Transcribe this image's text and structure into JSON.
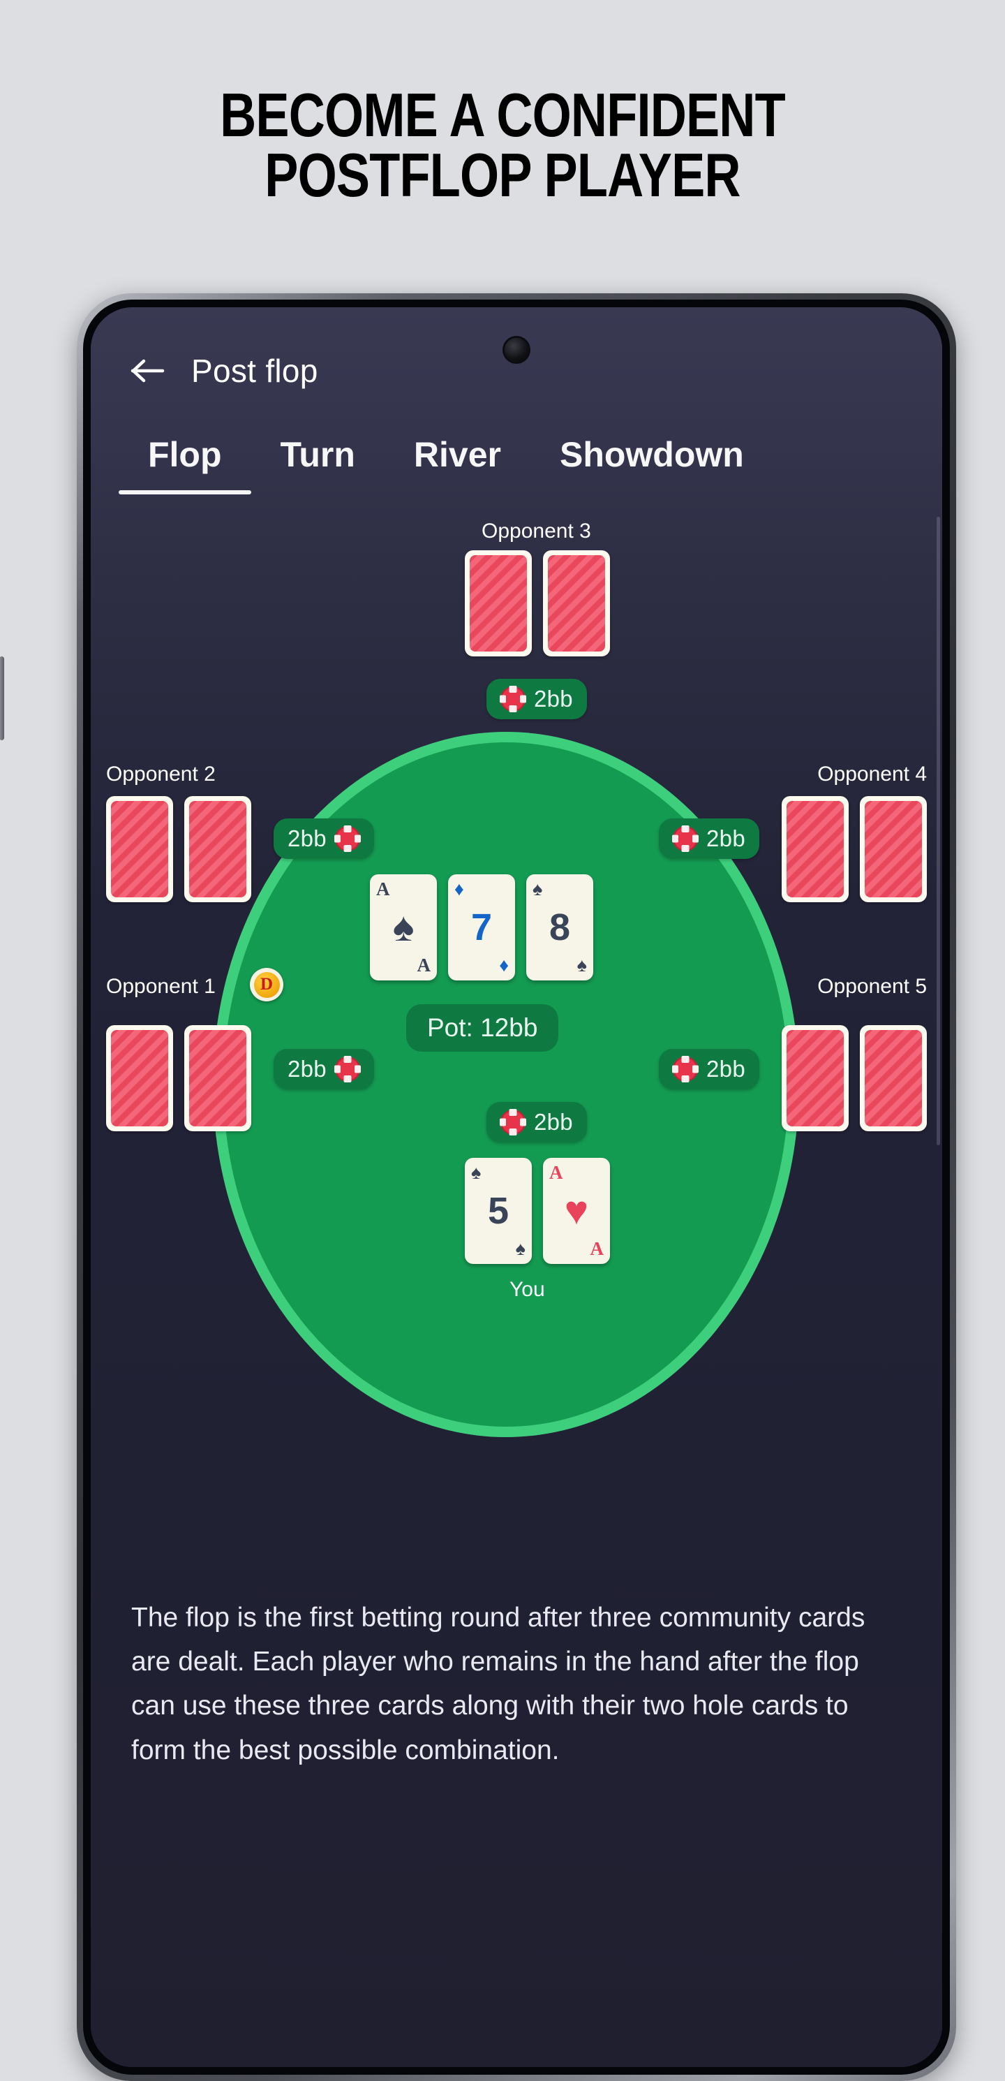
{
  "headline": {
    "line1": "BECOME A CONFIDENT",
    "line2": "POSTFLOP PLAYER"
  },
  "app": {
    "back_icon": "arrow-left-icon",
    "title": "Post flop",
    "tabs": [
      {
        "label": "Flop",
        "active": true
      },
      {
        "label": "Turn",
        "active": false
      },
      {
        "label": "River",
        "active": false
      },
      {
        "label": "Showdown",
        "active": false
      }
    ]
  },
  "table": {
    "pot_label": "Pot: 12bb",
    "dealer_badge": "D",
    "felt_color": "#149b52",
    "felt_rim_color": "#3ecf7d",
    "bet_badge_color": "#0e7a42",
    "chip_color": "#e8344a",
    "seats": [
      {
        "id": "opponent-3",
        "name": "Opponent 3",
        "bet": "2bb",
        "cards": "hidden"
      },
      {
        "id": "opponent-2",
        "name": "Opponent 2",
        "bet": "2bb",
        "cards": "hidden"
      },
      {
        "id": "opponent-4",
        "name": "Opponent 4",
        "bet": "2bb",
        "cards": "hidden"
      },
      {
        "id": "opponent-1",
        "name": "Opponent 1",
        "bet": "2bb",
        "cards": "hidden",
        "dealer": true
      },
      {
        "id": "opponent-5",
        "name": "Opponent 5",
        "bet": "2bb",
        "cards": "hidden"
      },
      {
        "id": "you",
        "name": "You",
        "bet": "2bb",
        "cards": "shown"
      }
    ],
    "community_cards": [
      {
        "rank": "A",
        "suit": "♠",
        "suit_name": "spade",
        "color": "#3a4458"
      },
      {
        "rank": "7",
        "suit": "♦",
        "suit_name": "diamond",
        "color": "#1565c8"
      },
      {
        "rank": "8",
        "suit": "♠",
        "suit_name": "spade",
        "color": "#3a4458"
      }
    ],
    "hole_cards": [
      {
        "rank": "5",
        "suit": "♠",
        "suit_name": "spade",
        "color": "#3a4458"
      },
      {
        "rank": "A",
        "suit": "♥",
        "suit_name": "heart",
        "color": "#e8435a"
      }
    ]
  },
  "description": {
    "text": "The flop is the first betting round after three community cards are dealt. Each player who remains in the hand after the flop can use these three cards along with their two hole cards to form the best possible combination."
  }
}
